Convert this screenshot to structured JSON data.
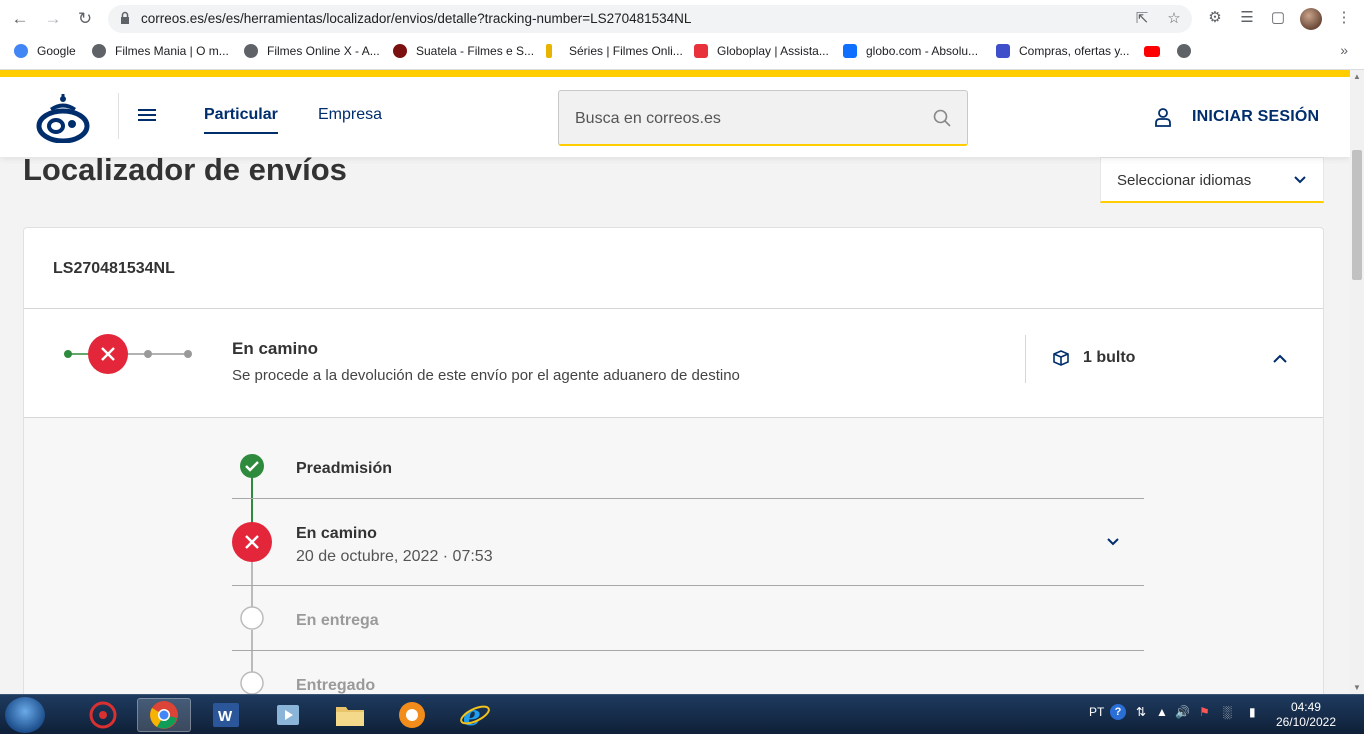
{
  "browser": {
    "url": "correos.es/es/es/herramientas/localizador/envios/detalle?tracking-number=LS270481534NL",
    "bookmarks": [
      {
        "label": "Google",
        "color": "#4285f4"
      },
      {
        "label": "Filmes Mania | O m...",
        "color": "#5f6368"
      },
      {
        "label": "Filmes Online X - A...",
        "color": "#5f6368"
      },
      {
        "label": "Suatela - Filmes e S...",
        "color": "#7a1010"
      },
      {
        "label": "Séries | Filmes Onli...",
        "color": "#e8b400"
      },
      {
        "label": "Globoplay | Assista...",
        "color": "#e8313b"
      },
      {
        "label": "globo.com - Absolu...",
        "color": "#0f6fff"
      },
      {
        "label": "Compras, ofertas y...",
        "color": "#3f4ec9"
      }
    ]
  },
  "header": {
    "tabs": [
      "Particular",
      "Empresa"
    ],
    "search_placeholder": "Busca en correos.es",
    "login_label": "INICIAR SESIÓN"
  },
  "page": {
    "title": "Localizador de envíos",
    "language_select": "Seleccionar idiomas"
  },
  "shipment": {
    "tracking_number": "LS270481534NL",
    "status_title": "En camino",
    "status_description": "Se procede a la devolución de este envío por el agente aduanero de destino",
    "packages_label": "1 bulto",
    "steps": [
      {
        "title": "Preadmisión",
        "state": "done",
        "date": ""
      },
      {
        "title": "En camino",
        "state": "error",
        "date": "20 de octubre, 2022 · 07:53"
      },
      {
        "title": "En entrega",
        "state": "pending",
        "date": ""
      },
      {
        "title": "Entregado",
        "state": "pending",
        "date": ""
      }
    ]
  },
  "taskbar": {
    "language": "PT",
    "time": "04:49",
    "date": "26/10/2022"
  },
  "colors": {
    "brand_yellow": "#ffcd00",
    "brand_blue": "#002e6d",
    "error_red": "#e3263a",
    "success_green": "#2e8b3d"
  }
}
